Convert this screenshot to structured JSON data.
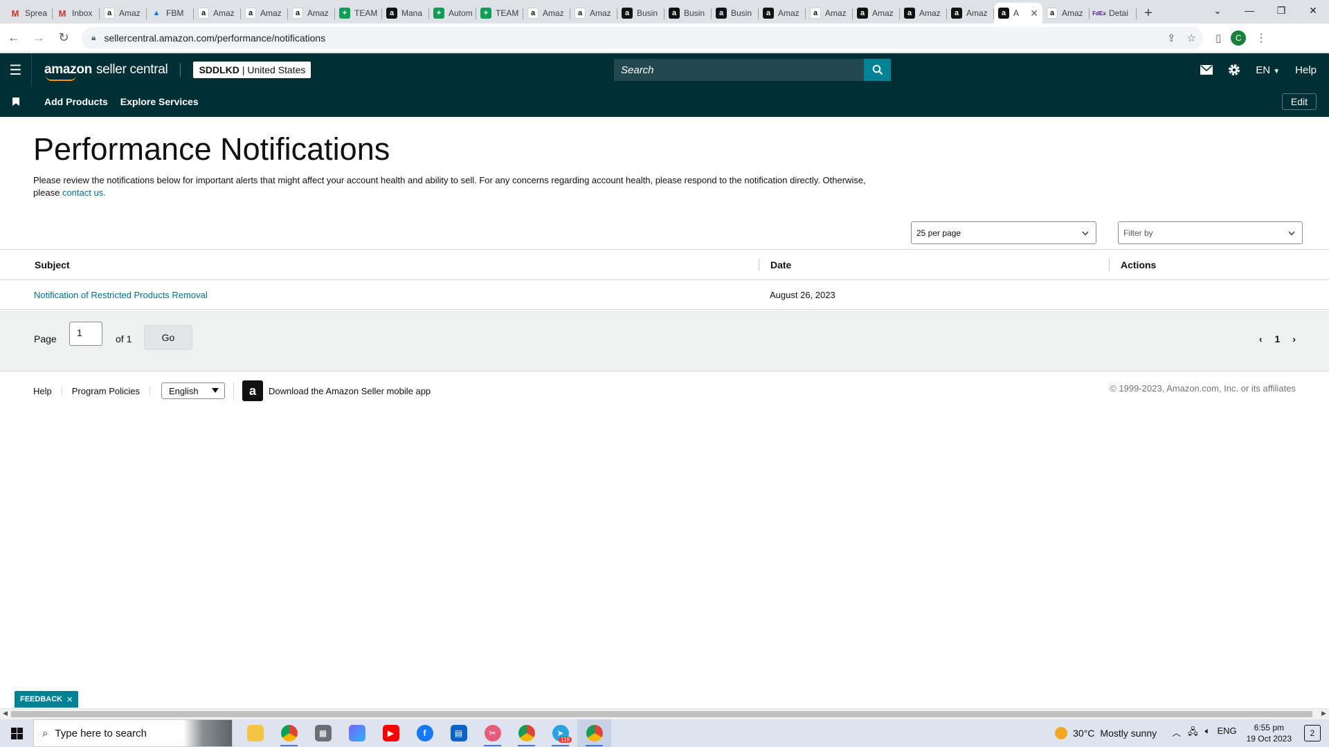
{
  "browser": {
    "tabs": [
      {
        "icon": "gmail",
        "title": "Sprea"
      },
      {
        "icon": "gmail",
        "title": "Inbox"
      },
      {
        "icon": "amz",
        "title": "Amaz"
      },
      {
        "icon": "drive",
        "title": "FBM"
      },
      {
        "icon": "amz",
        "title": "Amaz"
      },
      {
        "icon": "amz",
        "title": "Amaz"
      },
      {
        "icon": "amz",
        "title": "Amaz"
      },
      {
        "icon": "sheet",
        "title": "TEAM"
      },
      {
        "icon": "amzb",
        "title": "Mana"
      },
      {
        "icon": "sheet",
        "title": "Autom"
      },
      {
        "icon": "sheet",
        "title": "TEAM"
      },
      {
        "icon": "amz",
        "title": "Amaz"
      },
      {
        "icon": "amz",
        "title": "Amaz"
      },
      {
        "icon": "amzb",
        "title": "Busin"
      },
      {
        "icon": "amzb",
        "title": "Busin"
      },
      {
        "icon": "amzb",
        "title": "Busin"
      },
      {
        "icon": "amzb",
        "title": "Amaz"
      },
      {
        "icon": "amz",
        "title": "Amaz"
      },
      {
        "icon": "amzb",
        "title": "Amaz"
      },
      {
        "icon": "amzb",
        "title": "Amaz"
      },
      {
        "icon": "amzb",
        "title": "Amaz"
      },
      {
        "icon": "amzb",
        "title": "A",
        "active": true
      },
      {
        "icon": "amz",
        "title": "Amaz"
      },
      {
        "icon": "fedex",
        "title": "Detai"
      }
    ],
    "url": "sellercentral.amazon.com/performance/notifications"
  },
  "header": {
    "logo_amazon": "amazon",
    "logo_rest": "seller central",
    "store_bold": "SDDLKD",
    "store_rest": "| United States",
    "search_placeholder": "Search",
    "lang": "EN",
    "help": "Help"
  },
  "subnav": {
    "items": [
      "Add Products",
      "Explore Services"
    ],
    "edit": "Edit"
  },
  "page": {
    "title": "Performance Notifications",
    "intro": "Please review the notifications below for important alerts that might affect your account health and ability to sell. For any concerns regarding account health, please respond to the notification directly. Otherwise, please",
    "contact_link": "contact us.",
    "per_page": "25 per page",
    "filter_placeholder": "Filter by"
  },
  "table": {
    "columns": [
      "Subject",
      "Date",
      "Actions"
    ],
    "rows": [
      {
        "subject": "Notification of Restricted Products Removal",
        "date": "August 26, 2023",
        "actions": ""
      }
    ]
  },
  "pager": {
    "page_label": "Page",
    "page_value": "1",
    "of_label": "of 1",
    "go": "Go",
    "current": "1"
  },
  "footer": {
    "links": [
      "Help",
      "Program Policies"
    ],
    "language": "English",
    "app_text": "Download the Amazon Seller mobile app",
    "copyright": "© 1999-2023, Amazon.com, Inc. or its affiliates"
  },
  "feedback": "FEEDBACK",
  "taskbar": {
    "search_placeholder": "Type here to search",
    "weather_temp": "30°C",
    "weather_text": "Mostly sunny",
    "lang": "ENG",
    "time": "6:55 pm",
    "date": "19 Oct 2023",
    "notifications": "2",
    "telegram_badge": "119"
  },
  "colors": {
    "header_bg": "#002f36",
    "accent": "#008296",
    "link": "#00718f"
  }
}
